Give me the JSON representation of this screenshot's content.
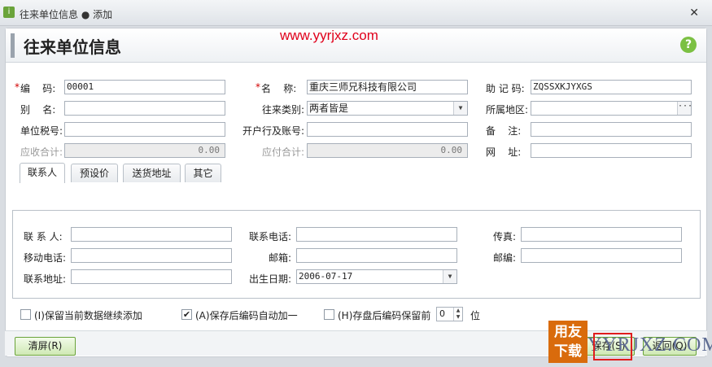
{
  "window": {
    "title": "往来单位信息 ● 添加",
    "close_glyph": "✕"
  },
  "header": {
    "title": "往来单位信息",
    "help_glyph": "?"
  },
  "watermark": "www.yyrjxz.com",
  "form": {
    "code": {
      "label": "编    码:",
      "value": "00001"
    },
    "name": {
      "label": "名    称:",
      "value": "重庆三师兄科技有限公司"
    },
    "mnemonic": {
      "label": "助 记 码:",
      "value": "ZQSSXKJYXGS"
    },
    "alias": {
      "label": "别    名:",
      "value": ""
    },
    "type": {
      "label": "往来类别:",
      "value": "两者皆是"
    },
    "region": {
      "label": "所属地区:",
      "value": ""
    },
    "tax_no": {
      "label": "单位税号:",
      "value": ""
    },
    "bank": {
      "label": "开户行及账号:",
      "value": ""
    },
    "remark": {
      "label": "备    注:",
      "value": ""
    },
    "receivable": {
      "label": "应收合计:",
      "value": "0.00"
    },
    "payable": {
      "label": "应付合计:",
      "value": "0.00"
    },
    "website": {
      "label": "网    址:",
      "value": ""
    }
  },
  "tabs": [
    {
      "label": "联系人",
      "active": true
    },
    {
      "label": "预设价",
      "active": false
    },
    {
      "label": "送货地址",
      "active": false
    },
    {
      "label": "其它",
      "active": false
    }
  ],
  "contact": {
    "person": {
      "label": "联 系 人:",
      "value": ""
    },
    "phone": {
      "label": "联系电话:",
      "value": ""
    },
    "fax": {
      "label": "传真:",
      "value": ""
    },
    "mobile": {
      "label": "移动电话:",
      "value": ""
    },
    "email": {
      "label": "邮箱:",
      "value": ""
    },
    "zip": {
      "label": "邮编:",
      "value": ""
    },
    "address": {
      "label": "联系地址:",
      "value": ""
    },
    "birthday": {
      "label": "出生日期:",
      "value": "2006-07-17"
    }
  },
  "options": {
    "keep_data": {
      "label": "(I)保留当前数据继续添加",
      "checked": false
    },
    "auto_increment": {
      "label": "(A)保存后编码自动加一",
      "checked": true
    },
    "keep_prefix": {
      "label": "(H)存盘后编码保留前",
      "checked": false
    },
    "prefix_digits": "0",
    "digits_unit": "位"
  },
  "buttons": {
    "clear": "清屏(R)",
    "save": "保存(S)",
    "back": "返回(Q)"
  },
  "logo": {
    "badge": "用友\n下载",
    "text": "YYRJXZ.COM"
  },
  "colors": {
    "accent_green": "#6aa33a",
    "watermark_red": "#e0001b",
    "logo_orange": "#d96b0c"
  }
}
